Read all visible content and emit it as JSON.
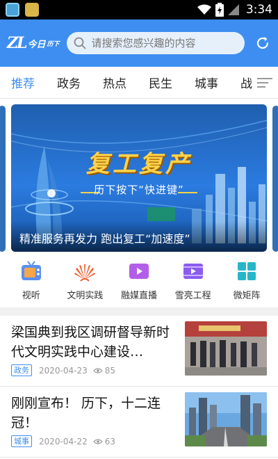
{
  "status": {
    "time": "3:34"
  },
  "header": {
    "logo_mark": "ZL",
    "logo_text": "今日",
    "logo_sub": "历下",
    "search_placeholder": "请搜索您感兴趣的内容"
  },
  "tabs": [
    {
      "label": "推荐",
      "active": true
    },
    {
      "label": "政务"
    },
    {
      "label": "热点"
    },
    {
      "label": "民生"
    },
    {
      "label": "城事"
    },
    {
      "label": "战"
    }
  ],
  "banner": {
    "headline": "复工复产",
    "sub": "历下按下“快进键”",
    "caption": "精准服务再发力 跑出复工“加速度”"
  },
  "quick_links": [
    {
      "label": "视听",
      "icon": "tv-icon",
      "color": "#5b8ff0"
    },
    {
      "label": "文明实践",
      "icon": "sunburst-icon",
      "color": "#ef5a2a"
    },
    {
      "label": "融媒直播",
      "icon": "video-icon",
      "color": "#b35ee8"
    },
    {
      "label": "雪亮工程",
      "icon": "film-icon",
      "color": "#8a5cf0"
    },
    {
      "label": "微矩阵",
      "icon": "grid-icon",
      "color": "#27b6c9"
    }
  ],
  "news": [
    {
      "title": "梁国典到我区调研督导新时代文明实践中心建设…",
      "tag": "政务",
      "date": "2020-04-23",
      "views": "85"
    },
    {
      "title": "刚刚宣布！ 历下，十二连冠！",
      "tag": "城事",
      "date": "2020-04-22",
      "views": "63"
    }
  ],
  "colors": {
    "accent": "#3d8ef0",
    "banner_headline": "#ffd24a"
  }
}
